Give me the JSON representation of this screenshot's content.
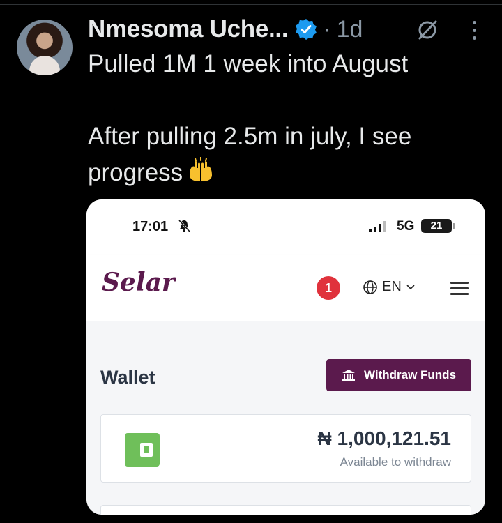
{
  "tweet": {
    "author_name": "Nmesoma Uche...",
    "separator": "·",
    "time_ago": "1d",
    "text": "Pulled 1M 1 week into August\n\nAfter pulling 2.5m in july, I see progress",
    "emoji": "raising-hands"
  },
  "phone": {
    "time": "17:01",
    "network": "5G",
    "battery": "21"
  },
  "app": {
    "logo": "Selar",
    "notification_count": "1",
    "language": "EN",
    "wallet_title": "Wallet",
    "withdraw_label": "Withdraw Funds",
    "balance": "₦ 1,000,121.51",
    "balance_caption": "Available to withdraw",
    "brand_color": "#5b1a4d",
    "wallet_icon_color": "#6fbf5a"
  }
}
